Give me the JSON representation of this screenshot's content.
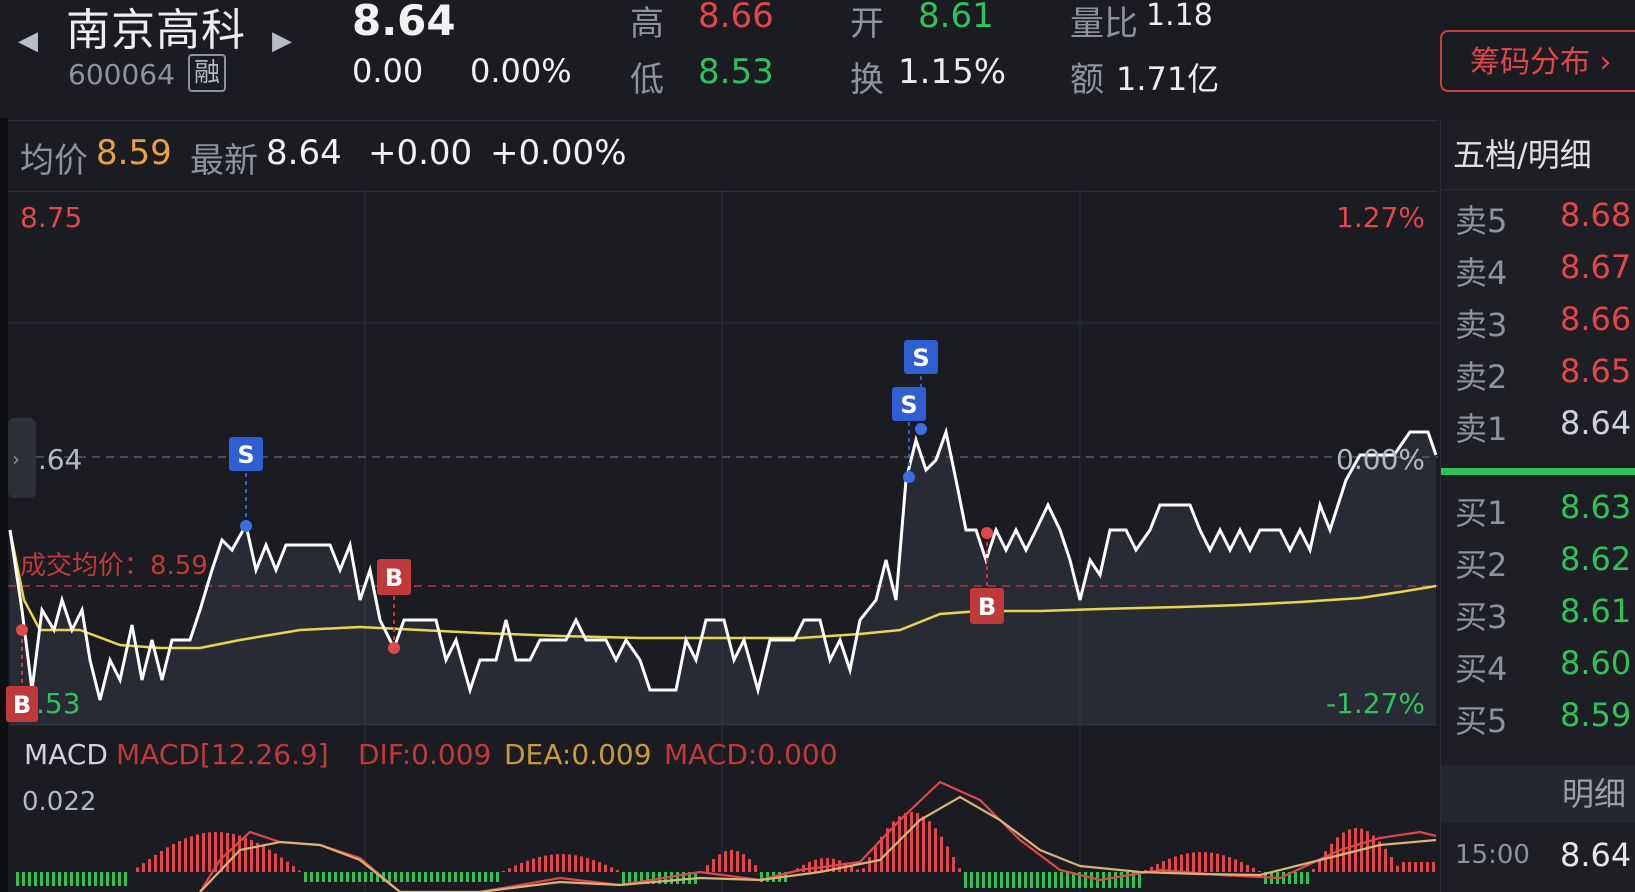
{
  "header": {
    "stock_name": "南京高科",
    "stock_code": "600064",
    "rong_badge": "融",
    "last_price": "8.64",
    "change": "0.00",
    "change_pct": "0.00%",
    "high_label": "高",
    "high": "8.66",
    "low_label": "低",
    "low": "8.53",
    "open_label": "开",
    "open": "8.61",
    "turnover_label": "换",
    "turnover": "1.15%",
    "vol_ratio_label": "量比",
    "vol_ratio": "1.18",
    "amount_label": "额",
    "amount": "1.71亿",
    "chip_button": "筹码分布 ›"
  },
  "infobar": {
    "avg_label": "均价",
    "avg_value": "8.59",
    "latest_label": "最新",
    "latest_value": "8.64",
    "change": "+0.00",
    "change_pct": "+0.00%"
  },
  "chart_axis": {
    "top_price": "8.75",
    "top_pct": "1.27%",
    "mid_price": "8.64",
    "mid_pct": "0.00%",
    "bottom_price": ".53",
    "bottom_pct": "-1.27%",
    "avg_line_label": "成交均价：8.59"
  },
  "markers": {
    "buy": "B",
    "sell": "S"
  },
  "macd": {
    "label": "MACD",
    "params": "MACD[12.26.9]",
    "dif": "DIF:0.009",
    "dea": "DEA:0.009",
    "macd": "MACD:0.000",
    "top_value": "0.022"
  },
  "side": {
    "tab": "五档/明细",
    "asks": [
      {
        "label": "卖5",
        "price": "8.68",
        "color": "#e0464a"
      },
      {
        "label": "卖4",
        "price": "8.67",
        "color": "#e0464a"
      },
      {
        "label": "卖3",
        "price": "8.66",
        "color": "#e0464a"
      },
      {
        "label": "卖2",
        "price": "8.65",
        "color": "#e0464a"
      },
      {
        "label": "卖1",
        "price": "8.64",
        "color": "#cfd2d8"
      }
    ],
    "bids": [
      {
        "label": "买1",
        "price": "8.63",
        "color": "#2fc25b"
      },
      {
        "label": "买2",
        "price": "8.62",
        "color": "#2fc25b"
      },
      {
        "label": "买3",
        "price": "8.61",
        "color": "#2fc25b"
      },
      {
        "label": "买4",
        "price": "8.60",
        "color": "#2fc25b"
      },
      {
        "label": "买5",
        "price": "8.59",
        "color": "#2fc25b"
      }
    ],
    "detail_header": "明细",
    "detail_time": "15:00",
    "detail_price": "8.64"
  },
  "colors": {
    "up": "#e0464a",
    "down": "#2fc25b",
    "avg": "#e8d548",
    "price_line": "#ffffff"
  }
}
